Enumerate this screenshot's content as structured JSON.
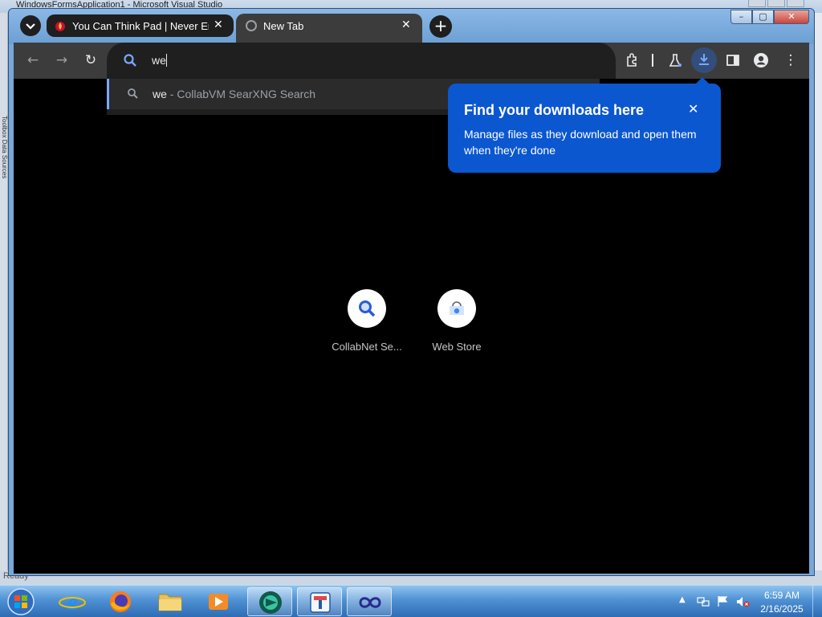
{
  "background_window": {
    "title": "WindowsFormsApplication1 - Microsoft Visual Studio",
    "side_label": "Toolbox  Data Sources",
    "status": "Ready"
  },
  "browser": {
    "tabs": [
      {
        "title": "You Can Think Pad | Never End",
        "active": false
      },
      {
        "title": "New Tab",
        "active": true
      }
    ],
    "omnibox": {
      "value": "we"
    },
    "suggestion": {
      "query": "we",
      "rest": " - CollabVM SearXNG Search"
    },
    "shortcuts": [
      {
        "label": "CollabNet Se..."
      },
      {
        "label": "Web Store"
      }
    ],
    "download_bubble": {
      "title": "Find your downloads here",
      "body": "Manage files as they download and open them when they're done"
    },
    "colors": {
      "accent": "#0b57d0",
      "toolbar": "#3c3c3c",
      "frame": "#6b9fd3"
    }
  },
  "taskbar": {
    "clock": {
      "time": "6:59 AM",
      "date": "2/16/2025"
    },
    "apps": [
      "internet-explorer",
      "firefox",
      "file-explorer",
      "media-player",
      "chrome",
      "app-blue-square",
      "app-infinity"
    ]
  }
}
